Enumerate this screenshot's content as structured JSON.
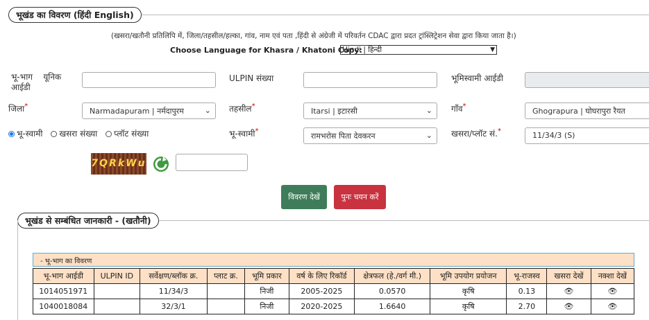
{
  "section1": {
    "title": "भूखंड का विवरण  (हिंदी  English)"
  },
  "info_note": "(खसरा/खतौनी प्रतिलिपि में, जिला/तहसील/हल्का, गांव, नाम एवं पता ,हिंदी से अंग्रेजी में परिवर्तन CDAC द्वारा प्रदत ट्रांस्लिट्रेशन सेवा द्वारा किया जाता है।)",
  "language": {
    "label": "Choose Language for Khasra / Khatoni Copy:",
    "selected": "Hindi | हिन्दी"
  },
  "form": {
    "unique_id_label": "भू-भाग    यूनिक\nआईडी",
    "unique_id_value": "",
    "ulpin_label": "ULPIN संख्या",
    "ulpin_value": "",
    "owner_id_label": "भूमिस्वामी आईडी",
    "owner_id_value": "",
    "district_label": "जिला",
    "district_value": "Narmadapuram | नर्मदापुरम",
    "tehsil_label": "तहसील",
    "tehsil_value": "Itarsi | इटारसी",
    "village_label": "गाँव",
    "village_value": "Ghograpura | घोघरापुरा रैयत",
    "search_by": [
      "भू-स्वामी",
      "खसरा संख्या",
      "प्लॉट संख्या"
    ],
    "owner_label": "भू-स्वामी",
    "owner_value": "रामभरोस पिता देवकरन",
    "khasra_label": "खसरा/प्लॉट सं.",
    "khasra_value": "11/34/3 (S)",
    "captcha_text": "7QRkWu",
    "captcha_input": ""
  },
  "buttons": {
    "view": "विवरण देखें",
    "reset": "पुनः चयन करें"
  },
  "section2": {
    "title": "भूखंड से सम्बंधित जानकारी -   (खतौनी)"
  },
  "table": {
    "caption": "- भू-भाग का विवरण",
    "headers": [
      "भू-भाग आईडी",
      "ULPIN ID",
      "सर्वेक्षण/ब्लॉक क्र.",
      "प्लाट क्र.",
      "भूमि प्रकार",
      "वर्ष के लिए रिकॉर्ड",
      "क्षेत्रफल (हे./वर्ग मी.)",
      "भूमि उपयोग प्रयोजन",
      "भू-राजस्व",
      "खसरा देखें",
      "नक्शा देखें"
    ],
    "rows": [
      [
        "1014051971",
        "",
        "11/34/3",
        "",
        "निजी",
        "2005-2025",
        "0.0570",
        "कृषि",
        "0.13"
      ],
      [
        "1040018084",
        "",
        "32/3/1",
        "",
        "निजी",
        "2020-2025",
        "1.6640",
        "कृषि",
        "2.70"
      ]
    ]
  },
  "colors": {
    "view_button": "#3f7d5a",
    "reset_button": "#c9323f",
    "table_header": "#fde0c5",
    "radio_active": "#1a73e8"
  },
  "icons": {
    "refresh": "refresh-icon",
    "view": "eye-icon",
    "dropdown": "chevron-down-icon"
  }
}
